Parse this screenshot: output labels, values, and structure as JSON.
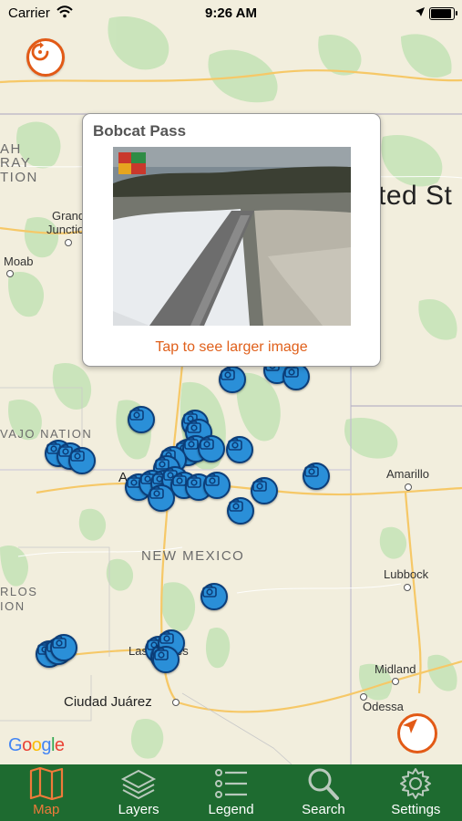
{
  "status_bar": {
    "carrier": "Carrier",
    "time": "9:26 AM"
  },
  "map": {
    "labels": {
      "united_states": "ted St",
      "new_mexico": "NEW MEXICO",
      "navajo_nation": "VAJO NATION",
      "utah_top1": "AH",
      "utah_top2": "RAY",
      "utah_top3": "TION",
      "grand": "Grand",
      "junction": "Junction",
      "moab": "Moab",
      "amarillo": "Amarillo",
      "lubbock": "Lubbock",
      "midland": "Midland",
      "odessa": "Odessa",
      "ciudad_juarez": "Ciudad Juárez",
      "al_prefix": "A",
      "las_cruces": "Las   Cruces",
      "rlos": "RLOS",
      "ion": "ION"
    },
    "attribution": "Google"
  },
  "popup": {
    "title": "Bobcat Pass",
    "caption": "Tap to see larger image"
  },
  "tabs": [
    {
      "label": "Map",
      "icon": "map-icon",
      "active": true
    },
    {
      "label": "Layers",
      "icon": "layers-icon",
      "active": false
    },
    {
      "label": "Legend",
      "icon": "list-icon",
      "active": false
    },
    {
      "label": "Search",
      "icon": "search-icon",
      "active": false
    },
    {
      "label": "Settings",
      "icon": "gear-icon",
      "active": false
    }
  ],
  "colors": {
    "accent": "#e25a16",
    "tabbar": "#1e6b30",
    "pin": "#2a8fd8"
  }
}
